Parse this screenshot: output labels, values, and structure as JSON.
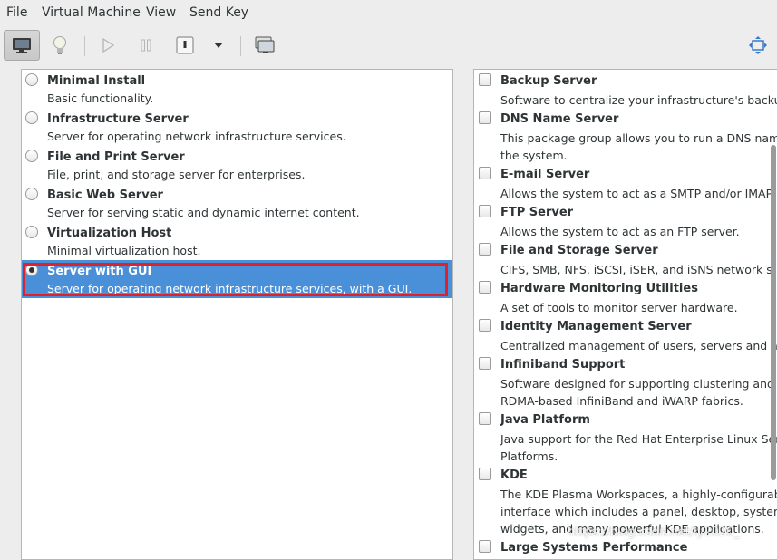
{
  "menubar": {
    "items": [
      "File",
      "Virtual Machine",
      "View",
      "Send Key"
    ]
  },
  "toolbar": {
    "buttons": [
      "monitor-icon",
      "lightbulb-icon",
      "play-icon",
      "pause-icon",
      "power-icon",
      "dropdown-arrow-icon",
      "screenshot-icon",
      "fullscreen-icon"
    ]
  },
  "environments": [
    {
      "title": "Minimal Install",
      "desc": "Basic functionality.",
      "selected": false
    },
    {
      "title": "Infrastructure Server",
      "desc": "Server for operating network infrastructure services.",
      "selected": false
    },
    {
      "title": "File and Print Server",
      "desc": "File, print, and storage server for enterprises.",
      "selected": false
    },
    {
      "title": "Basic Web Server",
      "desc": "Server for serving static and dynamic internet content.",
      "selected": false
    },
    {
      "title": "Virtualization Host",
      "desc": "Minimal virtualization host.",
      "selected": false
    },
    {
      "title": "Server with GUI",
      "desc": "Server for operating network infrastructure services, with a GUI.",
      "selected": true
    }
  ],
  "addons": [
    {
      "title": "Backup Server",
      "desc": [
        "Software to centralize your infrastructure's backu"
      ]
    },
    {
      "title": "DNS Name Server",
      "desc": [
        "This package group allows you to run a DNS nam",
        "the system."
      ]
    },
    {
      "title": "E-mail Server",
      "desc": [
        "Allows the system to act as a SMTP and/or IMAP"
      ]
    },
    {
      "title": "FTP Server",
      "desc": [
        "Allows the system to act as an FTP server."
      ]
    },
    {
      "title": "File and Storage Server",
      "desc": [
        "CIFS, SMB, NFS, iSCSI, iSER, and iSNS network s"
      ]
    },
    {
      "title": "Hardware Monitoring Utilities",
      "desc": [
        "A set of tools to monitor server hardware."
      ]
    },
    {
      "title": "Identity Management Server",
      "desc": [
        "Centralized management of users, servers and aut"
      ]
    },
    {
      "title": "Infiniband Support",
      "desc": [
        "Software designed for supporting clustering and g",
        "RDMA-based InfiniBand and iWARP fabrics."
      ]
    },
    {
      "title": "Java Platform",
      "desc": [
        "Java support for the Red Hat Enterprise Linux Serv",
        "Platforms."
      ]
    },
    {
      "title": "KDE",
      "desc": [
        "The KDE Plasma Workspaces, a highly-configurabl",
        "interface which includes a panel, desktop, system",
        "widgets, and many powerful KDE applications."
      ]
    },
    {
      "title": "Large Systems Performance",
      "desc": []
    }
  ],
  "watermark": "https://blog.csdn.net/ly2020_"
}
